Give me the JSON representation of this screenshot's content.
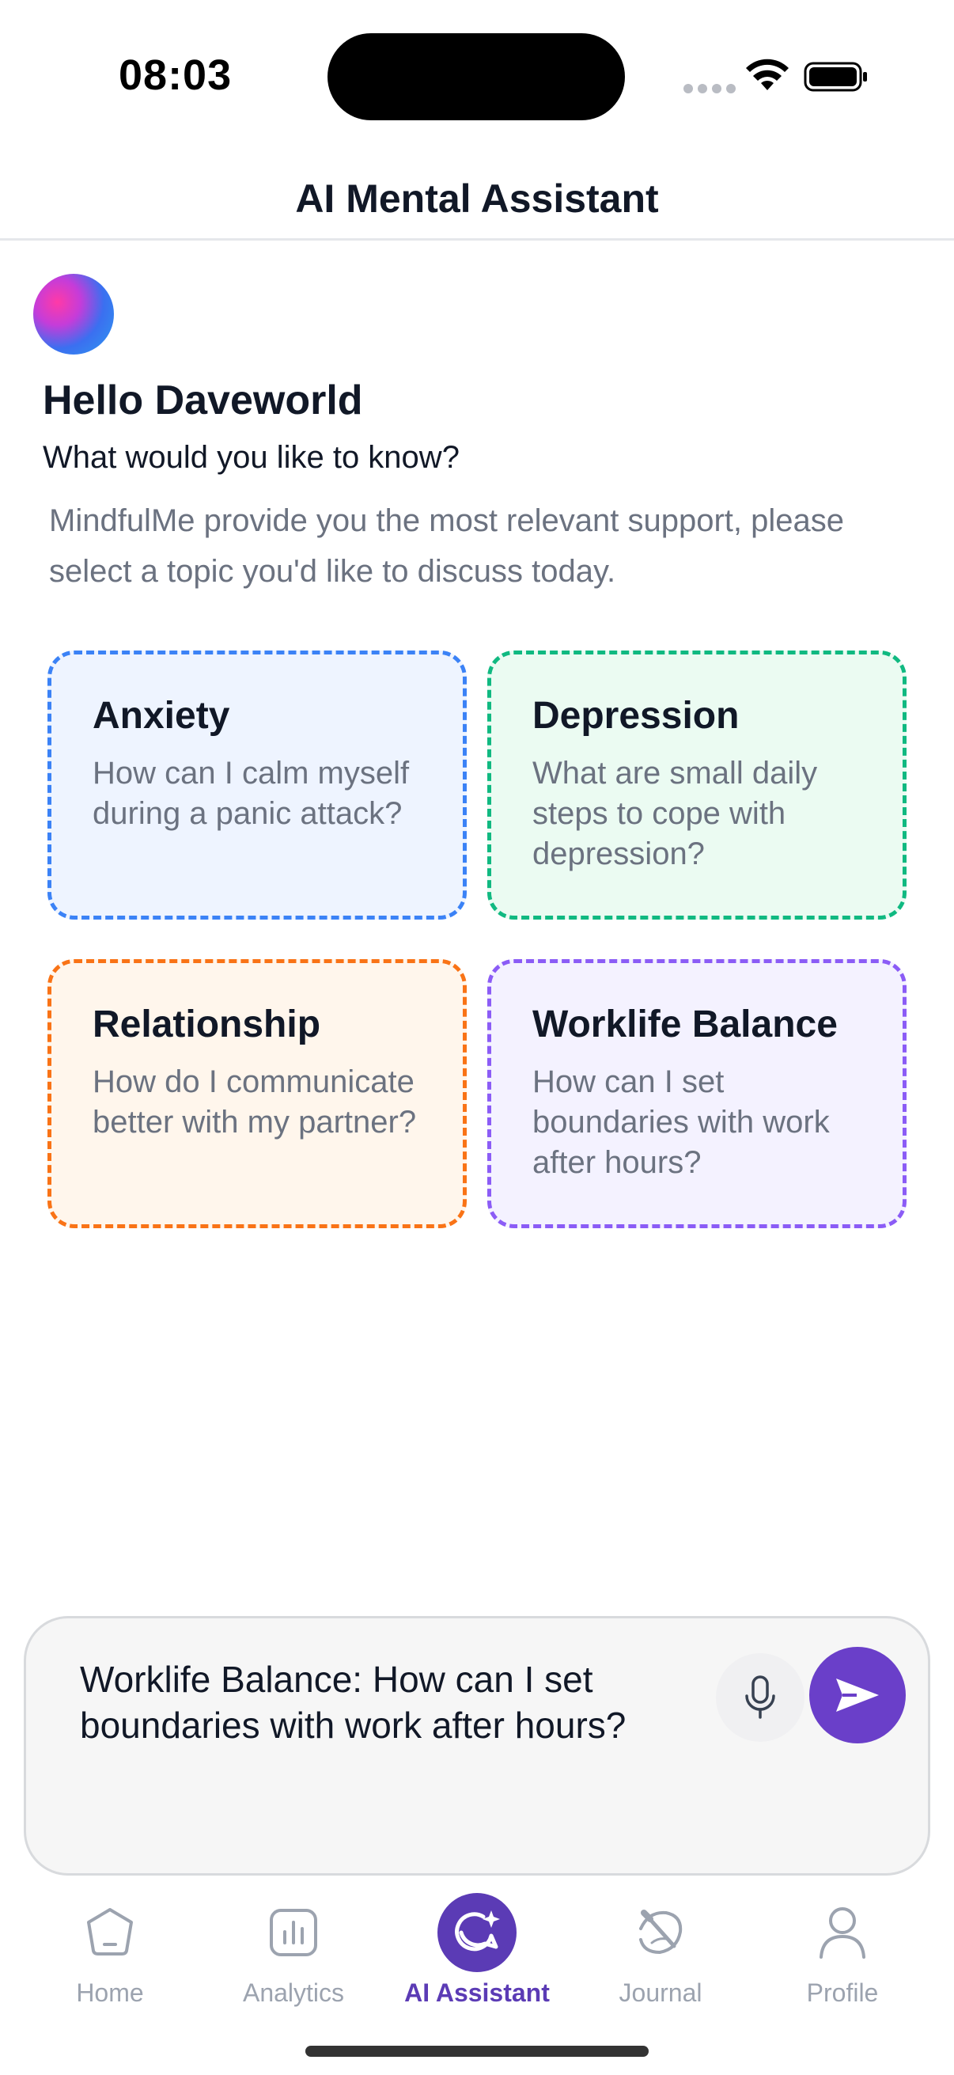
{
  "status_bar": {
    "time": "08:03"
  },
  "header": {
    "title": "AI Mental Assistant"
  },
  "greeting": {
    "title": "Hello Daveworld",
    "subtitle": "What would you like to know?",
    "intro": "MindfulMe provide you the most relevant support, please select a topic you'd like to discuss today."
  },
  "topics": [
    {
      "title": "Anxiety",
      "prompt": "How can I calm myself during a panic attack?",
      "color": "#3b82f6"
    },
    {
      "title": "Depression",
      "prompt": "What are small daily steps to cope with depression?",
      "color": "#10b981"
    },
    {
      "title": "Relationship",
      "prompt": "How do I communicate better with my partner?",
      "color": "#f97316"
    },
    {
      "title": "Worklife Balance",
      "prompt": "How can I set boundaries with work after hours?",
      "color": "#8b5cf6"
    }
  ],
  "composer": {
    "value": "Worklife Balance: How can I set boundaries with work after hours?",
    "mic_icon": "microphone-icon",
    "send_icon": "send-icon",
    "accent": "#6a3fc9"
  },
  "tabs": [
    {
      "label": "Home",
      "icon": "home-icon",
      "active": false
    },
    {
      "label": "Analytics",
      "icon": "analytics-icon",
      "active": false
    },
    {
      "label": "AI Assistant",
      "icon": "ai-assistant-icon",
      "active": true
    },
    {
      "label": "Journal",
      "icon": "journal-icon",
      "active": false
    },
    {
      "label": "Profile",
      "icon": "profile-icon",
      "active": false
    }
  ]
}
